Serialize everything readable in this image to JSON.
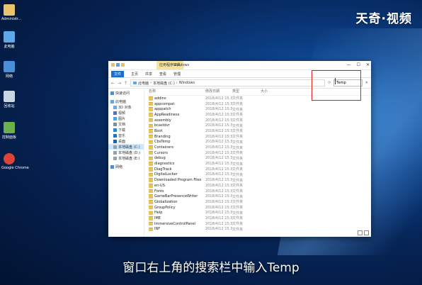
{
  "watermark": "天奇·视频",
  "desktop": {
    "icons": [
      {
        "label": "Administr...",
        "icon": "user-folder-icon",
        "color": "#e9c46a"
      },
      {
        "label": "此电脑",
        "icon": "computer-icon",
        "color": "#5fa8e8"
      },
      {
        "label": "网络",
        "icon": "network-icon",
        "color": "#4a90d9"
      },
      {
        "label": "回收站",
        "icon": "recycle-bin-icon",
        "color": "#c9d6e3"
      },
      {
        "label": "控制面板",
        "icon": "control-panel-icon",
        "color": "#6ab04c"
      },
      {
        "label": "Google Chrome",
        "icon": "chrome-icon",
        "color": "#db4437"
      }
    ]
  },
  "explorer": {
    "manage_tab": "应用程序工具",
    "title": "Windows",
    "window_buttons": [
      "—",
      "☐",
      "✕"
    ],
    "ribbon_tabs": [
      "文件",
      "主页",
      "共享",
      "查看",
      "管理"
    ],
    "address": [
      "此电脑",
      "本地磁盘 (C:)",
      "Windows"
    ],
    "search_value": "Temp",
    "nav_items": [
      {
        "label": "快速访问",
        "color": "#4a90d9"
      },
      {
        "label": "此电脑",
        "color": "#5fa8e8"
      },
      {
        "label": "3D 对象",
        "color": "#6aa9e0"
      },
      {
        "label": "视频",
        "color": "#5c6bc0"
      },
      {
        "label": "图片",
        "color": "#42a5f5"
      },
      {
        "label": "文档",
        "color": "#78909c"
      },
      {
        "label": "下载",
        "color": "#1e88e5"
      },
      {
        "label": "音乐",
        "color": "#1976d2"
      },
      {
        "label": "桌面",
        "color": "#1565c0"
      },
      {
        "label": "本地磁盘 (C:)",
        "color": "#90a4ae"
      },
      {
        "label": "本地磁盘 (D:)",
        "color": "#90a4ae"
      },
      {
        "label": "本地磁盘 (E:)",
        "color": "#90a4ae"
      },
      {
        "label": "网络",
        "color": "#4a90d9"
      }
    ],
    "selected_nav": 9,
    "columns": [
      "名称",
      "修改日期",
      "类型",
      "大小"
    ],
    "rows": [
      {
        "name": "addins",
        "date": "2018/4/12 15:3",
        "type": "文件夹"
      },
      {
        "name": "appcompat",
        "date": "2018/4/12 15:3",
        "type": "文件夹"
      },
      {
        "name": "apppatch",
        "date": "2018/4/12 15:3",
        "type": "文件夹"
      },
      {
        "name": "AppReadiness",
        "date": "2018/4/12 15:3",
        "type": "文件夹"
      },
      {
        "name": "assembly",
        "date": "2018/4/12 15:3",
        "type": "文件夹"
      },
      {
        "name": "bcastdvr",
        "date": "2018/4/12 15:3",
        "type": "文件夹"
      },
      {
        "name": "Boot",
        "date": "2018/4/12 15:3",
        "type": "文件夹"
      },
      {
        "name": "Branding",
        "date": "2018/4/12 15:3",
        "type": "文件夹"
      },
      {
        "name": "CbsTemp",
        "date": "2018/4/12 15:3",
        "type": "文件夹"
      },
      {
        "name": "Containers",
        "date": "2018/4/12 15:3",
        "type": "文件夹"
      },
      {
        "name": "Cursors",
        "date": "2018/4/12 15:3",
        "type": "文件夹"
      },
      {
        "name": "debug",
        "date": "2018/4/12 15:3",
        "type": "文件夹"
      },
      {
        "name": "diagnostics",
        "date": "2018/4/12 15:3",
        "type": "文件夹"
      },
      {
        "name": "DiagTrack",
        "date": "2018/4/12 15:3",
        "type": "文件夹"
      },
      {
        "name": "DigitalLocker",
        "date": "2018/4/12 15:3",
        "type": "文件夹"
      },
      {
        "name": "Downloaded Program Files",
        "date": "2018/4/12 15:3",
        "type": "文件夹"
      },
      {
        "name": "en-US",
        "date": "2018/4/12 15:3",
        "type": "文件夹"
      },
      {
        "name": "Fonts",
        "date": "2018/4/12 15:3",
        "type": "文件夹"
      },
      {
        "name": "GameBarPresenceWriter",
        "date": "2018/4/12 15:3",
        "type": "文件夹"
      },
      {
        "name": "Globalization",
        "date": "2018/4/12 15:3",
        "type": "文件夹"
      },
      {
        "name": "GroupPolicy",
        "date": "2018/4/12 15:3",
        "type": "文件夹"
      },
      {
        "name": "Help",
        "date": "2018/4/12 15:3",
        "type": "文件夹"
      },
      {
        "name": "IME",
        "date": "2018/4/12 15:3",
        "type": "文件夹"
      },
      {
        "name": "ImmersiveControlPanel",
        "date": "2018/4/12 15:3",
        "type": "文件夹"
      },
      {
        "name": "INF",
        "date": "2018/4/12 15:3",
        "type": "文件夹"
      }
    ]
  },
  "subtitle": "窗口右上角的搜索栏中输入Temp"
}
